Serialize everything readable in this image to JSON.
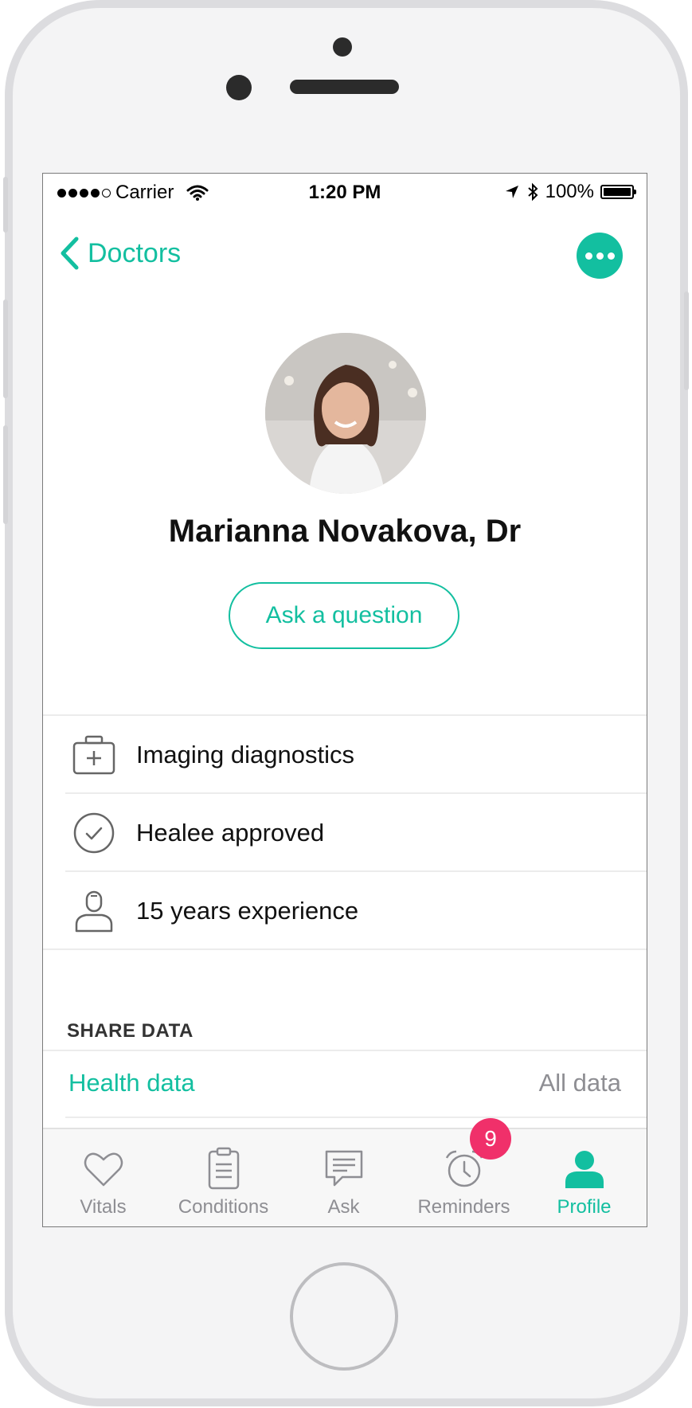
{
  "status_bar": {
    "carrier": "Carrier",
    "time": "1:20 PM",
    "battery": "100%",
    "signal_icon": "signal-dots-icon",
    "wifi_icon": "wifi-icon",
    "location_icon": "location-arrow-icon",
    "bluetooth_icon": "bluetooth-icon",
    "battery_icon": "battery-icon"
  },
  "nav": {
    "back_label": "Doctors",
    "back_icon": "chevron-left-icon",
    "more_icon": "more-dots-icon"
  },
  "doctor": {
    "name": "Marianna Novakova, Dr",
    "ask_label": "Ask a question"
  },
  "info": [
    {
      "icon": "medical-kit-icon",
      "label": "Imaging diagnostics"
    },
    {
      "icon": "check-circle-icon",
      "label": "Healee approved"
    },
    {
      "icon": "doctor-badge-icon",
      "label": "15 years experience"
    }
  ],
  "share": {
    "title": "SHARE DATA",
    "rows": [
      {
        "label": "Health data",
        "value": "All data"
      }
    ]
  },
  "tabs": [
    {
      "label": "Vitals",
      "icon": "heart-icon"
    },
    {
      "label": "Conditions",
      "icon": "clipboard-icon"
    },
    {
      "label": "Ask",
      "icon": "chat-icon"
    },
    {
      "label": "Reminders",
      "icon": "alarm-clock-icon",
      "badge": "9"
    },
    {
      "label": "Profile",
      "icon": "person-icon",
      "active": true
    }
  ],
  "colors": {
    "accent": "#13bfa0",
    "badge": "#f0306a",
    "muted": "#8e8e93"
  }
}
